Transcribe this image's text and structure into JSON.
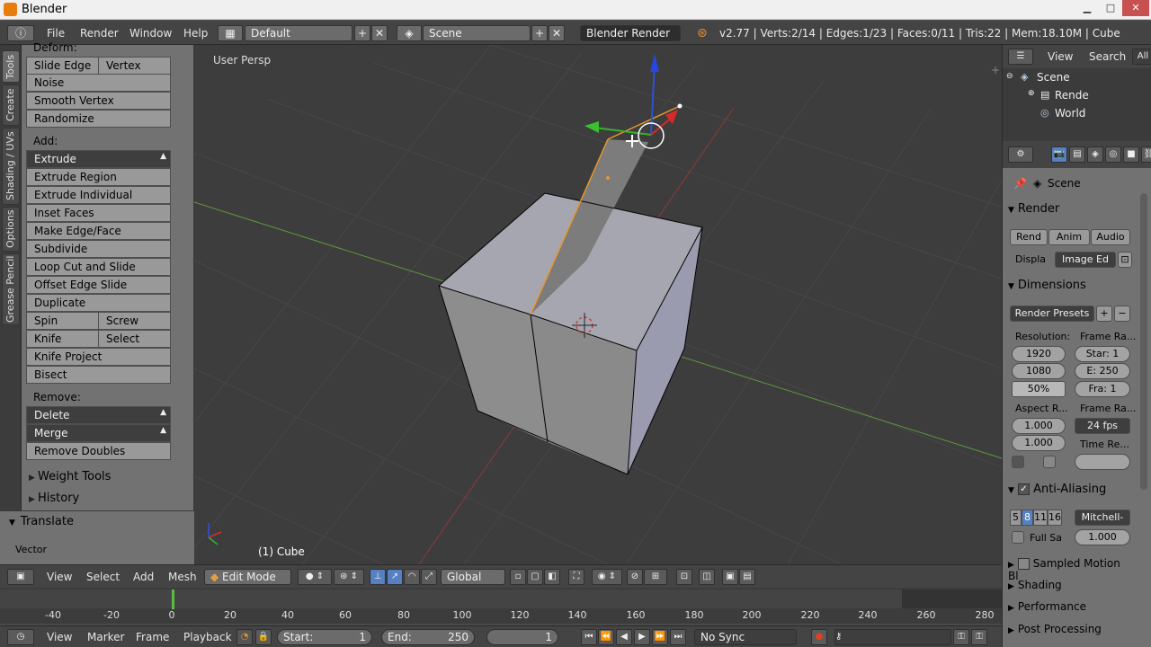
{
  "window": {
    "title": "Blender"
  },
  "infobar": {
    "menus": [
      "File",
      "Render",
      "Window",
      "Help"
    ],
    "layout": "Default",
    "scene": "Scene",
    "engine": "Blender Render",
    "stats": "v2.77 | Verts:2/14 | Edges:1/23 | Faces:0/11 | Tris:22 | Mem:18.10M | Cube"
  },
  "tabs": [
    "Tools",
    "Create",
    "Shading / UVs",
    "Options",
    "Grease Pencil"
  ],
  "toolshelf": {
    "deform_label": "Deform:",
    "slide_edge": "Slide Edge",
    "vertex": "Vertex",
    "noise": "Noise",
    "smooth_vertex": "Smooth Vertex",
    "randomize": "Randomize",
    "add_label": "Add:",
    "extrude": "Extrude",
    "extrude_region": "Extrude Region",
    "extrude_individual": "Extrude Individual",
    "inset_faces": "Inset Faces",
    "make_edge_face": "Make Edge/Face",
    "subdivide": "Subdivide",
    "loop_cut": "Loop Cut and Slide",
    "offset_edge": "Offset Edge Slide",
    "duplicate": "Duplicate",
    "spin": "Spin",
    "screw": "Screw",
    "knife": "Knife",
    "select": "Select",
    "knife_project": "Knife Project",
    "bisect": "Bisect",
    "remove_label": "Remove:",
    "delete": "Delete",
    "merge": "Merge",
    "remove_doubles": "Remove Doubles",
    "weight_tools": "Weight Tools",
    "history": "History",
    "translate": "Translate",
    "vector": "Vector"
  },
  "viewport": {
    "label": "User Persp",
    "object": "(1) Cube"
  },
  "vpheader": {
    "view": "View",
    "select": "Select",
    "add": "Add",
    "mesh": "Mesh",
    "mode": "Edit Mode",
    "orientation": "Global"
  },
  "timeline": {
    "ticks": [
      "-40",
      "-20",
      "0",
      "20",
      "40",
      "60",
      "80",
      "100",
      "120",
      "140",
      "160",
      "180",
      "200",
      "220",
      "240",
      "260",
      "280"
    ],
    "view": "View",
    "marker": "Marker",
    "frame": "Frame",
    "playback": "Playback",
    "start_label": "Start:",
    "start": "1",
    "end_label": "End:",
    "end": "250",
    "current": "1",
    "sync": "No Sync"
  },
  "outliner": {
    "view": "View",
    "search": "Search",
    "all": "All",
    "items": [
      "Scene",
      "Rende",
      "World"
    ]
  },
  "props": {
    "scene": "Scene",
    "render": "Render",
    "rend": "Rend",
    "anim": "Anim",
    "audio": "Audio",
    "display_label": "Displa",
    "display": "Image Ed",
    "dimensions": "Dimensions",
    "presets": "Render Presets",
    "resolution": "Resolution:",
    "res_x": "1920",
    "res_y": "1080",
    "res_pct": "50%",
    "frame_range": "Frame Ra...",
    "start": "Star: 1",
    "end": "E: 250",
    "frame": "Fra: 1",
    "aspect": "Aspect R...",
    "asp_x": "1.000",
    "asp_y": "1.000",
    "frame_rate": "Frame Ra...",
    "fps": "24 fps",
    "time_remap": "Time Re...",
    "antialiasing": "Anti-Aliasing",
    "aa_5": "5",
    "aa_8": "8",
    "aa_11": "11",
    "aa_16": "16",
    "filter": "Mitchell-",
    "full_sample": "Full Sa",
    "filter_size": "1.000",
    "sampled_motion": "Sampled Motion Bl",
    "shading": "Shading",
    "performance": "Performance",
    "post_processing": "Post Processing"
  }
}
